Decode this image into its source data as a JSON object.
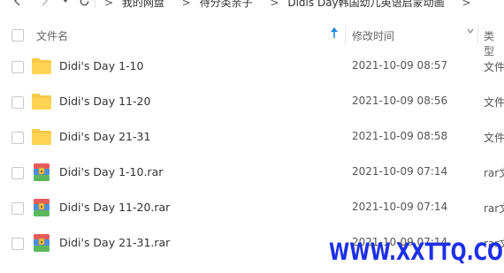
{
  "nav": {
    "breadcrumbs": [
      "我的网盘",
      "待分类亲子",
      "Didis Day韩国幼儿英语启蒙动画"
    ]
  },
  "columns": {
    "name": "文件名",
    "modified": "修改时间",
    "type": "类型"
  },
  "files": [
    {
      "name": "Didi's Day 1-10",
      "modified": "2021-10-09 08:57",
      "type": "文件",
      "kind": "folder-icon"
    },
    {
      "name": "Didi's Day 11-20",
      "modified": "2021-10-09 08:56",
      "type": "文件",
      "kind": "folder-icon"
    },
    {
      "name": "Didi's Day 21-31",
      "modified": "2021-10-09 08:58",
      "type": "文件",
      "kind": "folder-icon"
    },
    {
      "name": "Didi's Day 1-10.rar",
      "modified": "2021-10-09 07:14",
      "type": "rar文",
      "kind": "rar-archive-icon"
    },
    {
      "name": "Didi's Day 11-20.rar",
      "modified": "2021-10-09 07:14",
      "type": "rar文",
      "kind": "rar-archive-icon"
    },
    {
      "name": "Didi's Day 21-31.rar",
      "modified": "2021-10-09 07:14",
      "type": "rar文",
      "kind": "rar-archive-icon"
    }
  ],
  "watermark": "WWW.XXTTQ.COM",
  "colors": {
    "folder": "#f7c948",
    "accent": "#1e88e5",
    "watermark": "#1d2fe8"
  }
}
